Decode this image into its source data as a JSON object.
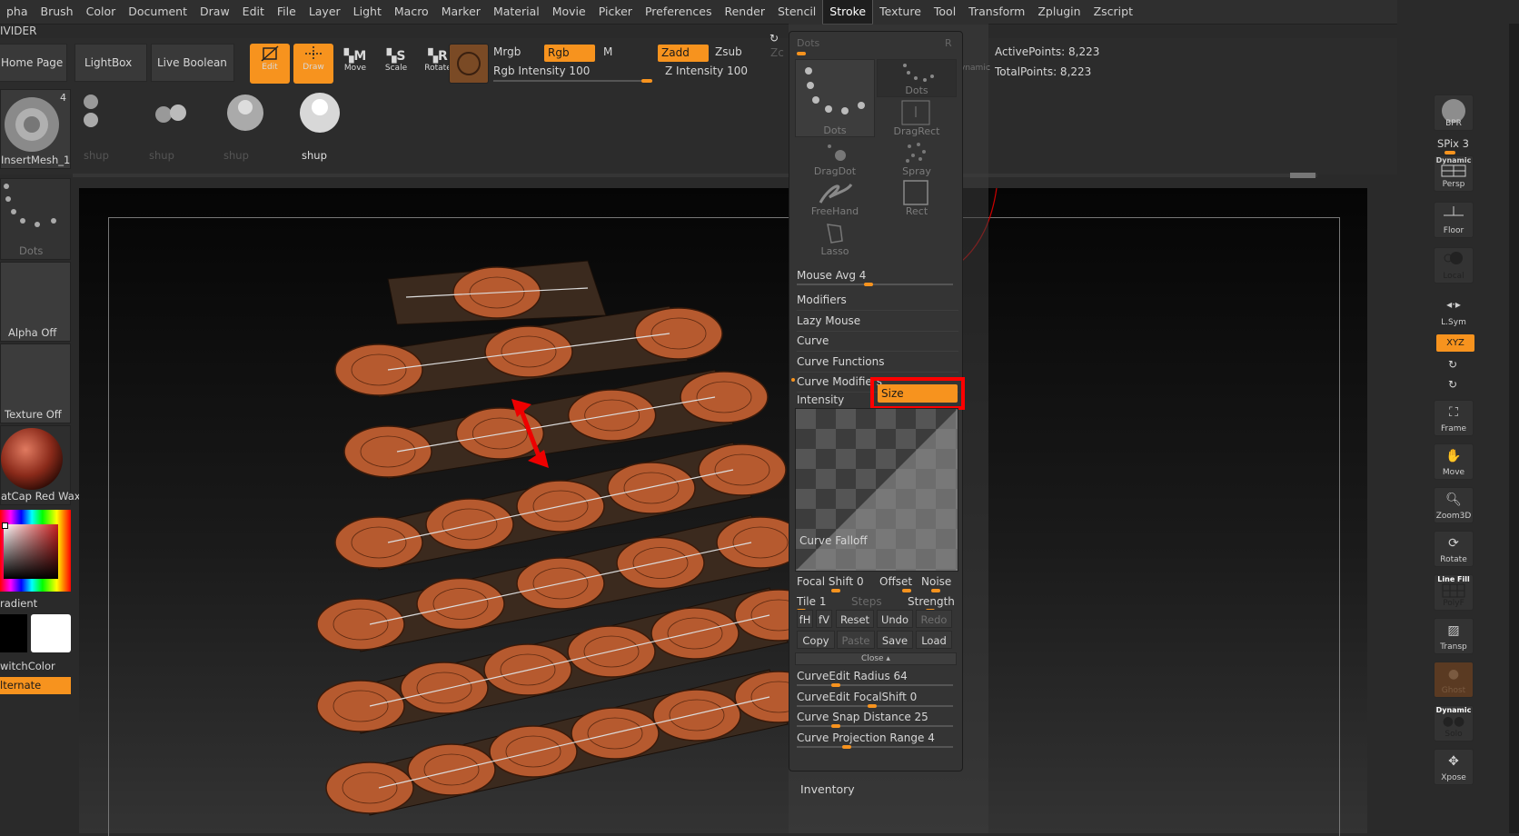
{
  "menu": {
    "items": [
      "pha",
      "Brush",
      "Color",
      "Document",
      "Draw",
      "Edit",
      "File",
      "Layer",
      "Light",
      "Macro",
      "Marker",
      "Material",
      "Movie",
      "Picker",
      "Preferences",
      "Render",
      "Stencil",
      "Stroke",
      "Texture",
      "Tool",
      "Transform",
      "Zplugin",
      "Zscript"
    ],
    "active": "Stroke"
  },
  "top": {
    "divider_label": "IVIDER",
    "home_page": "Home Page",
    "lightbox": "LightBox",
    "live_boolean": "Live Boolean",
    "edit": "Edit",
    "draw": "Draw",
    "move": "Move",
    "scale": "Scale",
    "rotate": "Rotate",
    "mrgb": "Mrgb",
    "rgb": "Rgb",
    "m": "M",
    "rgb_intensity": "Rgb Intensity 100",
    "zadd": "Zadd",
    "zsub": "Zsub",
    "z_intensity": "Z Intensity 100",
    "zc_partial": "Zc",
    "dynamic_partial": "ynamic",
    "active_points": "ActivePoints: 8,223",
    "total_points": "TotalPoints: 8,223"
  },
  "shelf": {
    "insert_mesh": "InsertMesh_1",
    "count": "4",
    "shups": [
      "shup",
      "shup",
      "shup",
      "shup"
    ]
  },
  "left": {
    "stroke": "Dots",
    "alpha": "Alpha Off",
    "texture": "Texture Off",
    "material": "atCap Red Wax",
    "gradient": "radient",
    "switch_color": "witchColor",
    "alternate": "lternate"
  },
  "right": {
    "bpr": "BPR",
    "spix": "SPix 3",
    "dynamic": "Dynamic",
    "persp": "Persp",
    "floor": "Floor",
    "local": "Local",
    "lsym": "L.Sym",
    "xyz": "XYZ",
    "frame": "Frame",
    "move": "Move",
    "zoom3d": "Zoom3D",
    "rotate": "Rotate",
    "line_fill": "Line Fill",
    "polyf": "PolyF",
    "transp": "Transp",
    "ghost": "Ghost",
    "solo_dynamic": "Dynamic",
    "solo": "Solo",
    "xpose": "Xpose"
  },
  "stroke_panel": {
    "dots_slider_label": "Dots",
    "r_label": "R",
    "strokes": [
      "Dots",
      "Dots",
      "DragRect",
      "DragDot",
      "Spray",
      "FreeHand",
      "Rect",
      "Lasso"
    ],
    "mouse_avg": "Mouse Avg 4",
    "sections": [
      "Modifiers",
      "Lazy Mouse",
      "Curve",
      "Curve Functions",
      "Curve Modifiers"
    ],
    "intensity": "Intensity",
    "size": "Size",
    "curve_falloff": "Curve Falloff",
    "focal_shift": "Focal Shift 0",
    "offset": "Offset",
    "noise": "Noise",
    "tile": "Tile 1",
    "steps": "Steps",
    "strength": "Strength",
    "fh": "fH",
    "fv": "fV",
    "reset": "Reset",
    "undo": "Undo",
    "redo": "Redo",
    "copy": "Copy",
    "paste": "Paste",
    "save": "Save",
    "load": "Load",
    "close": "Close",
    "curveedit_radius": "CurveEdit Radius 64",
    "curveedit_focalshift": "CurveEdit FocalShift 0",
    "curve_snap": "Curve Snap Distance 25",
    "curve_projection": "Curve Projection Range 4",
    "inventory": "Inventory"
  },
  "colors": {
    "accent": "#f7931e",
    "highlight_box": "#ff0000",
    "model": "#b85a30"
  }
}
